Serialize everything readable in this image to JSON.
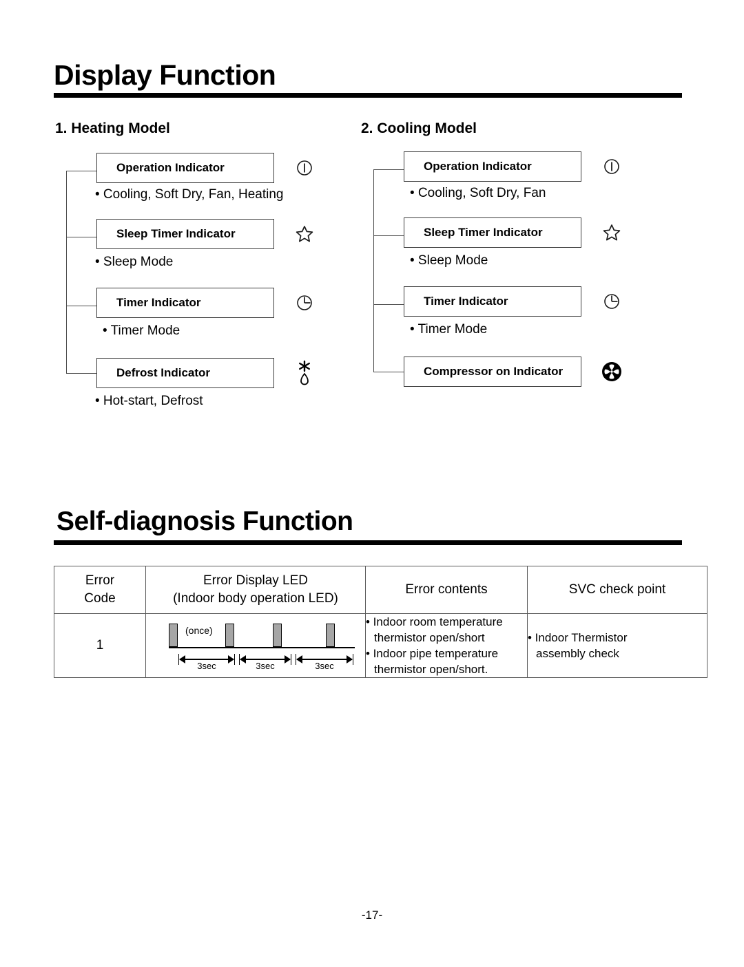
{
  "document": {
    "page_number": "-17-"
  },
  "sections": [
    {
      "title": "Display Function"
    },
    {
      "title": "Self-diagnosis Function"
    }
  ],
  "display_function": {
    "title": "Display Function",
    "models": [
      {
        "heading": "1. Heating Model",
        "indicators": [
          {
            "label": "Operation Indicator",
            "note": "• Cooling, Soft Dry, Fan, Heating",
            "icon": "power-icon"
          },
          {
            "label": "Sleep Timer Indicator",
            "note": "• Sleep Mode",
            "icon": "star-icon"
          },
          {
            "label": "Timer Indicator",
            "note": "• Timer Mode",
            "icon": "clock-icon"
          },
          {
            "label": "Defrost Indicator",
            "note": "• Hot-start, Defrost",
            "icon": "defrost-snowflake-drop-icon"
          }
        ]
      },
      {
        "heading": "2. Cooling Model",
        "indicators": [
          {
            "label": "Operation Indicator",
            "note": "• Cooling, Soft Dry, Fan",
            "icon": "power-icon"
          },
          {
            "label": "Sleep Timer Indicator",
            "note": "• Sleep Mode",
            "icon": "star-icon"
          },
          {
            "label": "Timer Indicator",
            "note": "• Timer Mode",
            "icon": "clock-icon"
          },
          {
            "label": "Compressor on Indicator",
            "note": "",
            "icon": "fan-propeller-icon"
          }
        ]
      }
    ]
  },
  "self_diagnosis": {
    "title": "Self-diagnosis Function",
    "table": {
      "headers": {
        "code_line1": "Error",
        "code_line2": "Code",
        "led_line1": "Error Display LED",
        "led_line2": "(Indoor body operation LED)",
        "contents": "Error contents",
        "svc": "SVC check point"
      },
      "rows": [
        {
          "code": "1",
          "led": {
            "once_label": "(once)",
            "pulse_count": 4,
            "interval_labels": [
              "3sec",
              "3sec",
              "3sec"
            ]
          },
          "contents": [
            {
              "bullet": "• Indoor room temperature",
              "sub": "thermistor open/short"
            },
            {
              "bullet": "• Indoor pipe temperature",
              "sub": "thermistor open/short."
            }
          ],
          "svc": [
            {
              "bullet": "• Indoor Thermistor",
              "sub": "assembly check"
            }
          ]
        }
      ]
    }
  },
  "colors": {
    "text": "#000000",
    "rule": "#000000",
    "box_border": "#3a3a3a",
    "table_border": "#595959",
    "pulse_fill": "#a6a6a6"
  }
}
